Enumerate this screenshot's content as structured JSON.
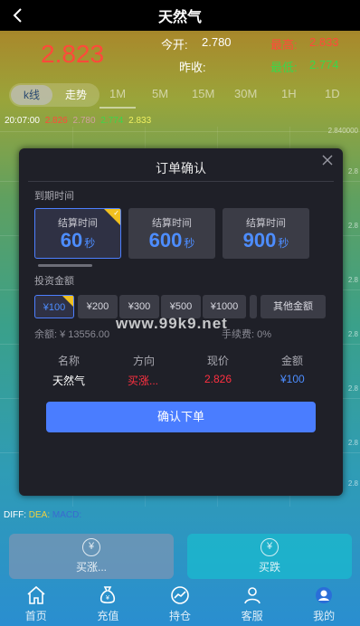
{
  "header": {
    "title": "天然气"
  },
  "price": {
    "current": "2.823",
    "open_label": "今开:",
    "open_value": "2.780",
    "prev_label": "昨收:",
    "high_label": "最高:",
    "high_value": "2.833",
    "low_label": "最低:",
    "low_value": "2.774"
  },
  "tabs": {
    "kline": "k线",
    "trend": "走势",
    "periods": [
      "1M",
      "5M",
      "15M",
      "30M",
      "1H",
      "1D"
    ]
  },
  "ticker": {
    "time": "20:07:00",
    "values": [
      "2.826",
      "2.780",
      "2.774",
      "2.833"
    ]
  },
  "chart_axis": {
    "labels": [
      "2.840000",
      "2.8",
      "2.8",
      "2.8",
      "2.8",
      "2.8",
      "2.8",
      "2.8"
    ]
  },
  "indicator": {
    "diff": "DIFF:",
    "dea": "DEA:",
    "macd": "MACD:"
  },
  "actions": {
    "buy_up": "买涨...",
    "buy_down": "买跌"
  },
  "nav": {
    "items": [
      "首页",
      "充值",
      "持仓",
      "客服",
      "我的"
    ]
  },
  "modal": {
    "title": "订单确认",
    "expiry_label": "到期时间",
    "expiry_options": [
      {
        "label": "结算时间",
        "num": "60",
        "unit": "秒"
      },
      {
        "label": "结算时间",
        "num": "600",
        "unit": "秒"
      },
      {
        "label": "结算时间",
        "num": "900",
        "unit": "秒"
      }
    ],
    "amount_label": "投资金额",
    "amounts": [
      "¥100",
      "¥200",
      "¥300",
      "¥500",
      "¥1000"
    ],
    "other_amount": "其他金额",
    "balance": "余额: ¥ 13556.00",
    "fee": "手续费: 0%",
    "table_headers": [
      "名称",
      "方向",
      "现价",
      "金额"
    ],
    "table_values": [
      "天然气",
      "买涨...",
      "2.826",
      "¥100"
    ],
    "confirm": "确认下单"
  },
  "watermark": "www.99k9.net"
}
